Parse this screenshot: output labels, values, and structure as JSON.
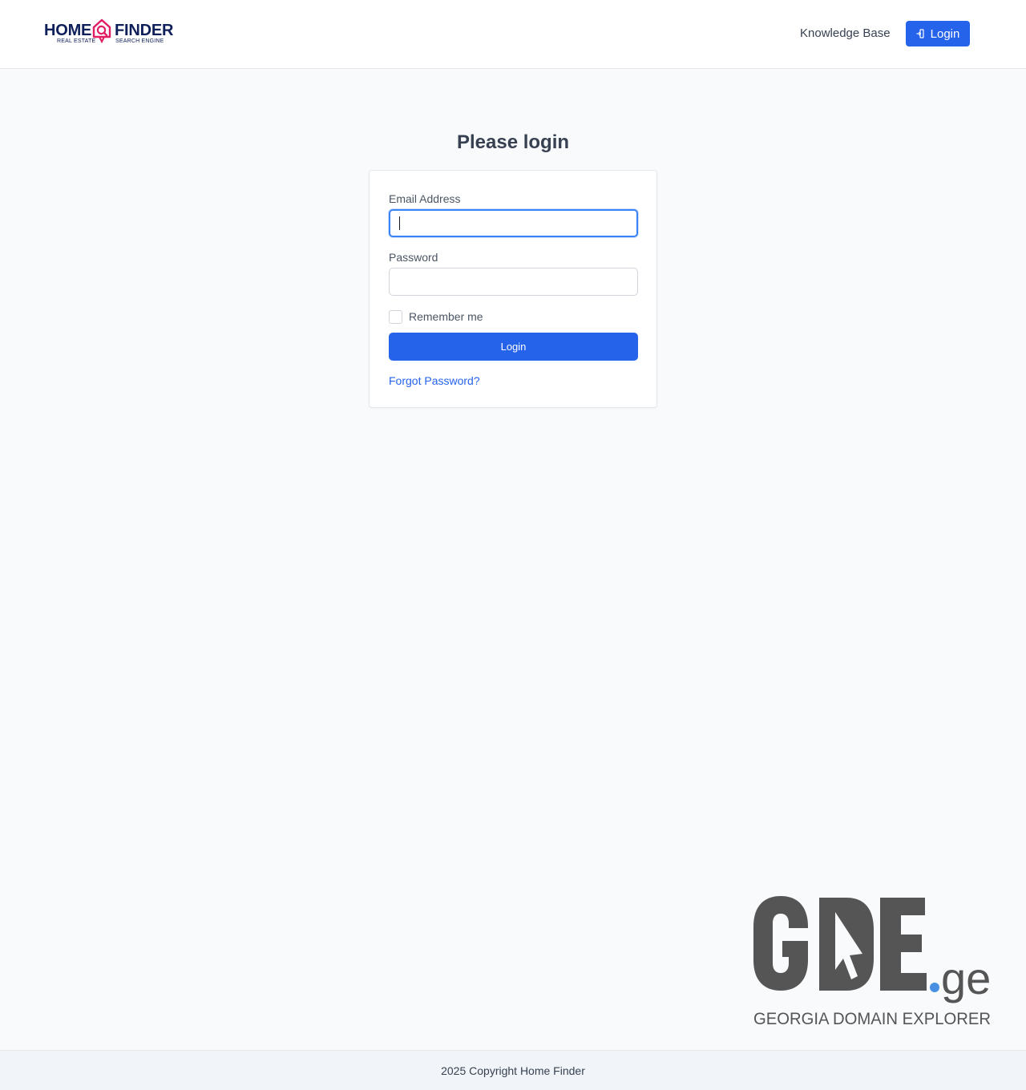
{
  "header": {
    "logo": {
      "word_left": "HOME",
      "word_right": "FINDER",
      "tagline_left": "REAL ESTATE",
      "tagline_right": "SEARCH ENGINE",
      "icon": "house-search-icon",
      "brand_color": "#0f1f5a",
      "accent_color": "#e11d64"
    },
    "nav": {
      "knowledge_base": "Knowledge Base",
      "login_label": "Login",
      "login_icon": "sign-in-icon"
    }
  },
  "main": {
    "title": "Please login",
    "form": {
      "email_label": "Email Address",
      "email_value": "",
      "password_label": "Password",
      "password_value": "",
      "remember_label": "Remember me",
      "remember_checked": false,
      "submit_label": "Login",
      "forgot_label": "Forgot Password?"
    }
  },
  "watermark": {
    "mark": "GDE",
    "tld": ".ge",
    "caption": "GEORGIA DOMAIN EXPLORER",
    "color": "#555555",
    "dot_color": "#4a90e2"
  },
  "footer": {
    "copyright": "2025 Copyright Home Finder"
  },
  "colors": {
    "primary": "#2563eb",
    "background": "#f8fafc"
  }
}
